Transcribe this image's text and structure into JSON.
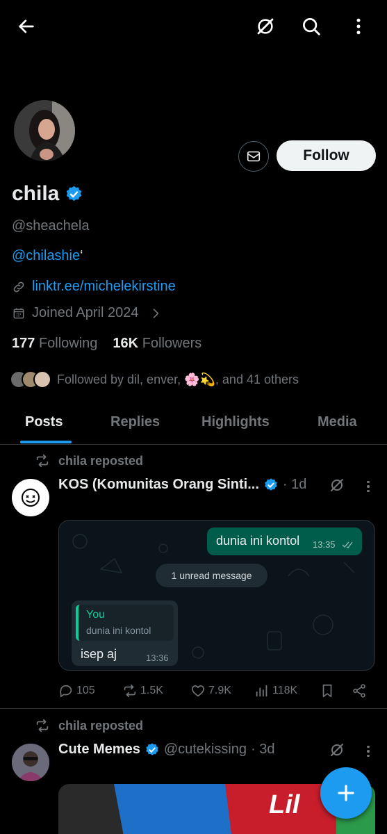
{
  "header": {
    "back_icon": "arrow-left-icon",
    "grok_icon": "grok-icon",
    "search_icon": "search-icon",
    "more_icon": "more-vertical-icon"
  },
  "profile": {
    "name": "chila",
    "handle": "@sheachela",
    "bio_link": "@chilashie",
    "bio_suffix": "‘",
    "website": "linktr.ee/michelekirstine",
    "joined": "Joined April 2024",
    "following_count": "177",
    "following_label": "Following",
    "followers_count": "16K",
    "followers_label": "Followers",
    "followed_by": "Followed by dil, enver, 🌸💫, and 41 others",
    "follow_label": "Follow",
    "accent": "#1d9bf0"
  },
  "tabs": [
    {
      "label": "Posts",
      "active": true
    },
    {
      "label": "Replies",
      "active": false
    },
    {
      "label": "Highlights",
      "active": false
    },
    {
      "label": "Media",
      "active": false
    }
  ],
  "posts": [
    {
      "repost_label": "chila reposted",
      "author": "KOS (Komunitas Orang Sinti...",
      "meta": "· 1d",
      "chat": {
        "out_text": "dunia ini kontol",
        "out_time": "13:35",
        "unread": "1 unread message",
        "quote_who": "You",
        "quote_text": "dunia ini kontol",
        "in_text": "isep aj",
        "in_time": "13:36"
      },
      "stats": {
        "replies": "105",
        "reposts": "1.5K",
        "likes": "7.9K",
        "views": "118K"
      }
    },
    {
      "repost_label": "chila reposted",
      "author": "Cute Memes",
      "handle": "@cutekissing",
      "meta": "· 3d",
      "media_text": "Lil"
    }
  ]
}
